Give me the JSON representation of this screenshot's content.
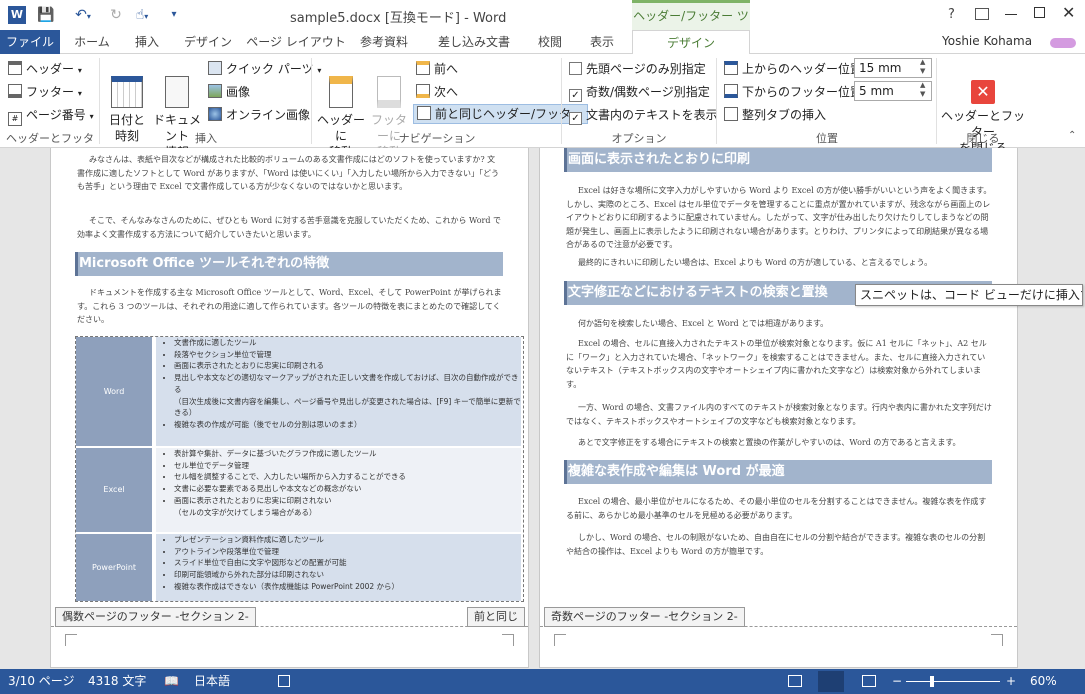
{
  "window": {
    "title": "sample5.docx [互換モード] - Word",
    "context_tab_group": "ヘッダー/フッター ツール",
    "help": "?",
    "user": "Yoshie Kohama"
  },
  "tabs": [
    "ファイル",
    "ホーム",
    "挿入",
    "デザイン",
    "ページ レイアウト",
    "参考資料",
    "差し込み文書",
    "校閲",
    "表示",
    "デザイン"
  ],
  "ribbon": {
    "hf_group": {
      "label": "ヘッダーとフッター",
      "header": "ヘッダー",
      "footer": "フッター",
      "page_number": "ページ番号"
    },
    "insert_group": {
      "label": "挿入",
      "date_time": "日付と\n時刻",
      "doc_info": "ドキュメント\n情報",
      "quick_parts": "クイック パーツ",
      "picture": "画像",
      "online_picture": "オンライン画像"
    },
    "nav_group": {
      "label": "ナビゲーション",
      "goto_header": "ヘッダーに\n移動",
      "goto_footer": "フッターに\n移動",
      "prev": "前へ",
      "next": "次へ",
      "link_prev": "前と同じヘッダー/フッター"
    },
    "options_group": {
      "label": "オプション",
      "first_page": "先頭ページのみ別指定",
      "first_page_checked": false,
      "odd_even": "奇数/偶数ページ別指定",
      "odd_even_checked": true,
      "show_text": "文書内のテキストを表示",
      "show_text_checked": true
    },
    "position_group": {
      "label": "位置",
      "header_pos_label": "上からのヘッダー位置:",
      "header_pos": "15 mm",
      "footer_pos_label": "下からのフッター位置:",
      "footer_pos": "5 mm",
      "align_tab": "整列タブの挿入"
    },
    "close_group": {
      "label": "閉じる",
      "close": "ヘッダーとフッター\nを閉じる"
    }
  },
  "left_page": {
    "para1": "みなさんは、表紙や目次などが構成された比較的ボリュームのある文書作成にはどのソフトを使っていますか? 文書作成に適したソフトとして Word がありますが、「Word は使いにくい」「入力したい場所から入力できない」「どうも苦手」という理由で Excel で文書作成している方が少なくないのではないかと思います。",
    "para2": "そこで、そんなみなさんのために、ぜひとも Word に対する苦手意識を克服していただくため、これから Word で効率よく文書作成する方法について紹介していきたいと思います。",
    "heading": "Microsoft Office ツールそれぞれの特徴",
    "para3": "ドキュメントを作成する主な Microsoft Office ツールとして、Word、Excel、そして PowerPoint が挙げられます。これら 3 つのツールは、それぞれの用途に適して作られています。各ツールの特徴を表にまとめたので確認してください。",
    "table": [
      {
        "name": "Word",
        "items": [
          "文書作成に適したツール",
          "段落やセクション単位で管理",
          "画面に表示されたとおりに忠実に印刷される",
          "見出しや本文などの適切なマークアップがされた正しい文書を作成しておけば、目次の自動作成ができる",
          "（目次生成後に文書内容を編集し、ページ番号や見出しが変更された場合は、[F9] キーで簡単に更新できる）",
          "複雑な表の作成が可能（後でセルの分割は思いのまま）"
        ]
      },
      {
        "name": "Excel",
        "items": [
          "表計算や集計、データに基づいたグラフ作成に適したツール",
          "セル単位でデータ管理",
          "セル幅を調整することで、入力したい場所から入力することができる",
          "文書に必要な要素である見出しや本文などの概念がない",
          "画面に表示されたとおりに忠実に印刷されない",
          "（セルの文字が欠けてしまう場合がある）"
        ]
      },
      {
        "name": "PowerPoint",
        "items": [
          "プレゼンテーション資料作成に適したツール",
          "アウトラインや段落単位で管理",
          "スライド単位で自由に文字や図形などの配置が可能",
          "印刷可能領域から外れた部分は印刷されない",
          "複雑な表作成はできない（表作成機能は PowerPoint 2002 から）"
        ]
      }
    ],
    "footer_tag": "偶数ページのフッター -セクション 2-",
    "same_as_prev": "前と同じ"
  },
  "right_page": {
    "heading1": "画面に表示されたとおりに印刷",
    "p1": "Excel は好きな場所に文字入力がしやすいから Word より Excel の方が使い勝手がいいという声をよく聞きます。しかし、実際のところ、Excel はセル単位でデータを管理することに重点が置かれていますが、残念ながら画面上のレイアウトどおりに印刷するように配慮されていません。したがって、文字が仕み出したり欠けたりしてしまうなどの問題が発生し、画面上に表示したように印刷されない場合があります。とりわけ、プリンタによって印刷結果が異なる場合があるので注意が必要です。",
    "p2": "最終的にきれいに印刷したい場合は、Excel よりも Word の方が適している、と言えるでしょう。",
    "heading2": "文字修正などにおけるテキストの検索と置換",
    "p3": "何か語句を検索したい場合、Excel と Word とでは相違があります。",
    "p4": "Excel の場合、セルに直接入力されたテキストの単位が検索対象となります。仮に A1 セルに「ネット」、A2 セルに「ワーク」と入力されていた場合、「ネットワーク」を検索することはできません。また、セルに直接入力されていないテキスト（テキストボックス内の文字やオートシェイプ内に書かれた文字など）は検索対象から外れてしまいます。",
    "p5": "一方、Word の場合、文書ファイル内のすべてのテキストが検索対象となります。行内や表内に書かれた文字列だけではなく、テキストボックスやオートシェイプの文字なども検索対象となります。",
    "p6": "あとで文字修正をする場合にテキストの検索と置換の作業がしやすいのは、Word の方であると言えます。",
    "heading3": "複雑な表作成や編集は Word が最適",
    "p7": "Excel の場合、最小単位がセルになるため、その最小単位のセルを分割することはできません。複雑な表を作成する前に、あらかじめ最小基準のセルを見極める必要があります。",
    "p8": "しかし、Word の場合、セルの制限がないため、自由自在にセルの分割や結合ができます。複雑な表のセルの分割や結合の操作は、Excel よりも Word の方が簡単です。",
    "footer_tag": "奇数ページのフッター -セクション 2-"
  },
  "tooltip": "スニペットは、コード ビューだけに挿入する",
  "status": {
    "page": "3/10 ページ",
    "words": "4318 文字",
    "lang": "日本語",
    "zoom": "60%"
  },
  "colors": {
    "accent": "#2b579a",
    "heading_bg": "#a2b4cc",
    "close_red": "#e8453c"
  }
}
